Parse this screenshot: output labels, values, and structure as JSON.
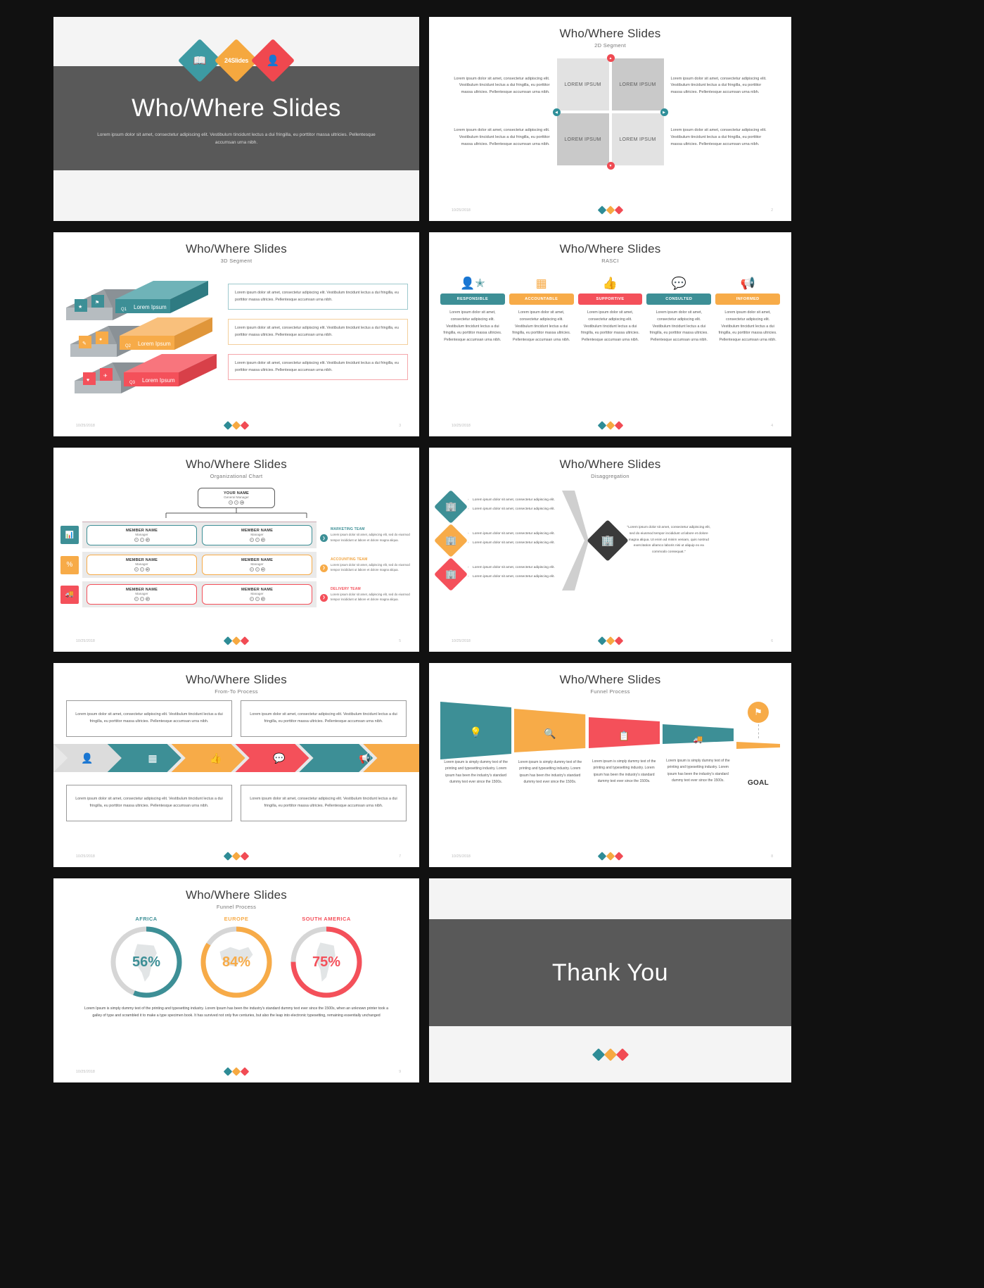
{
  "deck": {
    "title": "Who/Where Slides",
    "date": "10/25/2018",
    "brand_badge": "24Slides",
    "colors": {
      "teal": "#3d8f96",
      "orange": "#f7ab48",
      "red": "#f4505a",
      "dark": "#595959"
    }
  },
  "lorem": {
    "full": "Lorem ipsum dolor sit amet, consectetur adipiscing elit. Vestibulum tincidunt lectus a dui fringilla, eu porttitor massa ultricies. Pellentesque accumsan urna nibh.",
    "short": "Lorem ipsum dolor sit amet, consectetur adipiscing elit.",
    "med": "Lorem ipsum dolor sit amet, consectetur adipiscing elit. Vestibulum tincidunt lectus a dui fringilla, eu porttitor massa ultricies. Pellentesque accumsan urna nibh.",
    "note": "Lorem ipsum dolor sit amet, consectetur adipiscing elit. Vestibulum tincidunt lectus a dui fringilla, eu porttitor massa ultricies. Pellentesque accumsan urna nibh.",
    "team": "Lorem ipsum dolor sit amet, consectetur adipiscing elit, sed do eiusmod tempor incididunt ut labore et dolore magna aliqua.",
    "funnel": "Lorem ipsum is simply dummy text of the printing and typesetting industry. Lorem ipsum has been the industry's standard dummy text ever since the 1500s.",
    "quote": "\"Lorem ipsum dolor sit amet, consectetur adipiscing elit, sed do eiusmod tempor incididunt ut labore et dolore magna aliqua. Ut enim ad minim veniam, quis nostrud exercitation ullamco laboris nisi ut aliquip ex ea commodo consequat.\"",
    "donut_foot": "Lorem Ipsum is simply dummy text of the printing and typesetting industry. Lorem Ipsum has been the industry's standard dummy text ever since the 1500s, when an unknown printer took a galley of type and scrambled it to make a type specimen book. It has survived not only five centuries, but also the leap into electronic typesetting, remaining essentially unchanged"
  },
  "slides": [
    {
      "id": 1,
      "kind": "cover",
      "title": "Who/Where Slides",
      "subtitle": "",
      "body": "Lorem ipsum dolor sit amet, consectetur adipiscing elit. Vestibulum tincidunt lectus a dui fringilla, eu porttitor massa ultricies. Pellentesque accumsan urna nibh.",
      "icons": [
        "book-icon",
        "brand-24slides",
        "user-icon"
      ]
    },
    {
      "id": 2,
      "kind": "2d-segment",
      "subtitle": "2D Segment",
      "page": "2",
      "cells": [
        "LOREM IPSUM",
        "LOREM IPSUM",
        "LOREM IPSUM",
        "LOREM IPSUM"
      ],
      "texts": [
        "Lorem ipsum dolor sit amet, consectetur adipiscing elit. Vestibulum tincidunt lectus a dui fringilla, eu porttitor massa ultricies. Pellentesque accumsan urna nibh.",
        "Lorem ipsum dolor sit amet, consectetur adipiscing elit. Vestibulum tincidunt lectus a dui fringilla, eu porttitor massa ultricies. Pellentesque accumsan urna nibh.",
        "Lorem ipsum dolor sit amet, consectetur adipiscing elit. Vestibulum tincidunt lectus a dui fringilla, eu porttitor massa ultricies. Pellentesque accumsan urna nibh.",
        "Lorem ipsum dolor sit amet, consectetur adipiscing elit. Vestibulum tincidunt lectus a dui fringilla, eu porttitor massa ultricies. Pellentesque accumsan urna nibh."
      ]
    },
    {
      "id": 3,
      "kind": "3d-segment",
      "subtitle": "3D Segment",
      "page": "3",
      "slab_labels": [
        "Lorem Ipsum",
        "Lorem Ipsum",
        "Lorem Ipsum"
      ],
      "slab_tags": [
        "Q1",
        "Q2",
        "Q3"
      ],
      "notes": [
        "Lorem ipsum dolor sit amet, consectetur adipiscing elit. Vestibulum tincidunt lectus a dui fringilla, eu porttitor massa ultricies. Pellentesque accumsan urna nibh.",
        "Lorem ipsum dolor sit amet, consectetur adipiscing elit. Vestibulum tincidunt lectus a dui fringilla, eu porttitor massa ultricies. Pellentesque accumsan urna nibh.",
        "Lorem ipsum dolor sit amet, consectetur adipiscing elit. Vestibulum tincidunt lectus a dui fringilla, eu porttitor massa ultricies. Pellentesque accumsan urna nibh."
      ]
    },
    {
      "id": 4,
      "kind": "rasci",
      "subtitle": "RASCI",
      "page": "4",
      "columns": [
        {
          "tag": "RESPONSIBLE",
          "color": "teal",
          "icon": "user-star-icon",
          "body": "Lorem ipsum dolor sit amet, consectetur adipiscing elit. Vestibulum tincidunt lectus a dui fringilla, eu porttitor massa ultricies. Pellentesque accumsan urna nibh."
        },
        {
          "tag": "ACCOUNTABLE",
          "color": "orange",
          "icon": "abacus-icon",
          "body": "Lorem ipsum dolor sit amet, consectetur adipiscing elit. Vestibulum tincidunt lectus a dui fringilla, eu porttitor massa ultricies. Pellentesque accumsan urna nibh."
        },
        {
          "tag": "SUPPORTIVE",
          "color": "red",
          "icon": "thumbs-up-icon",
          "body": "Lorem ipsum dolor sit amet, consectetur adipiscing elit. Vestibulum tincidunt lectus a dui fringilla, eu porttitor massa ultricies. Pellentesque accumsan urna nibh."
        },
        {
          "tag": "CONSULTED",
          "color": "teal",
          "icon": "speech-bubbles-icon",
          "body": "Lorem ipsum dolor sit amet, consectetur adipiscing elit. Vestibulum tincidunt lectus a dui fringilla, eu porttitor massa ultricies. Pellentesque accumsan urna nibh."
        },
        {
          "tag": "INFORMED",
          "color": "orange",
          "icon": "megaphone-icon",
          "body": "Lorem ipsum dolor sit amet, consectetur adipiscing elit. Vestibulum tincidunt lectus a dui fringilla, eu porttitor massa ultricies. Pellentesque accumsan urna nibh."
        }
      ]
    },
    {
      "id": 5,
      "kind": "org-chart",
      "subtitle": "Organizational Chart",
      "page": "5",
      "root": {
        "name": "YOUR NAME",
        "role": "General Manager"
      },
      "members": [
        {
          "name": "MEMBER NAME",
          "role": "Manager"
        },
        {
          "name": "MEMBER NAME",
          "role": "Manager"
        },
        {
          "name": "MEMBER NAME",
          "role": "Manager"
        },
        {
          "name": "MEMBER NAME",
          "role": "Manager"
        },
        {
          "name": "MEMBER NAME",
          "role": "Manager"
        },
        {
          "name": "MEMBER NAME",
          "role": "Manager"
        }
      ],
      "teams": [
        {
          "label": "MARKETING TEAM",
          "color": "teal",
          "icon": "chart-icon",
          "body": "Lorem ipsum dolor sit amet, adipiscing elit, sed do eiusmod tempor incididunt ut labore et dolore magna aliqua."
        },
        {
          "label": "ACCOUNTING TEAM",
          "color": "orange",
          "icon": "percent-icon",
          "body": "Lorem ipsum dolor sit amet, adipiscing elit, sed do eiusmod tempor incididunt ut labore et dolore magna aliqua."
        },
        {
          "label": "DELIVERY TEAM",
          "color": "red",
          "icon": "truck-icon",
          "body": "Lorem ipsum dolor sit amet, adipiscing elit, sed do eiusmod tempor incididunt ut labore et dolore magna aliqua."
        }
      ]
    },
    {
      "id": 6,
      "kind": "disaggregation",
      "subtitle": "Disaggregation",
      "page": "6",
      "groups": [
        {
          "color": "teal",
          "icon": "building-icon",
          "bullets": [
            "Lorem ipsum dolor sit amet, consectetur adipiscing elit.",
            "Lorem ipsum dolor sit amet, consectetur adipiscing elit."
          ]
        },
        {
          "color": "orange",
          "icon": "building-icon",
          "bullets": [
            "Lorem ipsum dolor sit amet, consectetur adipiscing elit.",
            "Lorem ipsum dolor sit amet, consectetur adipiscing elit."
          ]
        },
        {
          "color": "red",
          "icon": "building-icon",
          "bullets": [
            "Lorem ipsum dolor sit amet, consectetur adipiscing elit.",
            "Lorem ipsum dolor sit amet, consectetur adipiscing elit."
          ]
        }
      ],
      "result_icon": "building-icon",
      "quote": "\"Lorem ipsum dolor sit amet, consectetur adipiscing elit, sed do eiusmod tempor incididunt ut labore et dolore magna aliqua. Ut enim ad minim veniam, quis nostrud exercitation ullamco laboris nisi ut aliquip ex ea commodo consequat.\""
    },
    {
      "id": 7,
      "kind": "from-to",
      "subtitle": "From-To Process",
      "page": "7",
      "top_boxes": [
        "Lorem ipsum dolor sit amet, consectetur adipiscing elit. Vestibulum tincidunt lectus a dui fringilla, eu porttitor massa ultricies. Pellentesque accumsan urna nibh.",
        "Lorem ipsum dolor sit amet, consectetur adipiscing elit. Vestibulum tincidunt lectus a dui fringilla, eu porttitor massa ultricies. Pellentesque accumsan urna nibh."
      ],
      "bottom_boxes": [
        "Lorem ipsum dolor sit amet, consectetur adipiscing elit. Vestibulum tincidunt lectus a dui fringilla, eu porttitor massa ultricies. Pellentesque accumsan urna nibh.",
        "Lorem ipsum dolor sit amet, consectetur adipiscing elit. Vestibulum tincidunt lectus a dui fringilla, eu porttitor massa ultricies. Pellentesque accumsan urna nibh."
      ],
      "arrows": [
        {
          "color": "teal",
          "icon": "user-star-icon"
        },
        {
          "color": "orange",
          "icon": "abacus-icon"
        },
        {
          "color": "red",
          "icon": "thumbs-up-icon"
        },
        {
          "color": "teal",
          "icon": "speech-bubbles-icon"
        },
        {
          "color": "orange",
          "icon": "megaphone-icon"
        }
      ]
    },
    {
      "id": 8,
      "kind": "funnel",
      "subtitle": "Funnel Process",
      "page": "8",
      "goal_label": "GOAL",
      "steps": [
        {
          "color": "teal",
          "icon": "lightbulb-icon",
          "text": "Lorem ipsum is simply dummy text of the printing and typesetting industry. Lorem ipsum has been the industry's standard dummy text ever since the 1500s."
        },
        {
          "color": "orange",
          "icon": "search-icon",
          "text": "Lorem ipsum is simply dummy text of the printing and typesetting industry. Lorem ipsum has been the industry's standard dummy text ever since the 1500s."
        },
        {
          "color": "red",
          "icon": "clipboard-icon",
          "text": "Lorem ipsum is simply dummy text of the printing and typesetting industry. Lorem ipsum has been the industry's standard dummy text ever since the 1500s."
        },
        {
          "color": "teal",
          "icon": "truck-icon",
          "text": "Lorem ipsum is simply dummy text of the printing and typesetting industry. Lorem ipsum has been the industry's standard dummy text ever since the 1500s."
        }
      ],
      "flag_icon": "flag-icon"
    },
    {
      "id": 9,
      "kind": "donuts",
      "subtitle": "Funnel Process",
      "page": "9",
      "footer_text": "Lorem Ipsum is simply dummy text of the printing and typesetting industry. Lorem Ipsum has been the industry's standard dummy text ever since the 1500s, when an unknown printer took a galley of type and scrambled it to make a type specimen book. It has survived not only five centuries, but also the leap into electronic typesetting, remaining essentially unchanged"
    },
    {
      "id": 10,
      "kind": "thank-you",
      "title": "Thank You"
    }
  ],
  "chart_data": {
    "type": "pie",
    "title": "Who/Where Slides — Funnel Process",
    "charts": [
      {
        "label": "AFRICA",
        "value": 56,
        "display": "56%",
        "color": "#3d8f96",
        "track": "#d6d6d6",
        "max": 100
      },
      {
        "label": "EUROPE",
        "value": 84,
        "display": "84%",
        "color": "#f7ab48",
        "track": "#d6d6d6",
        "max": 100
      },
      {
        "label": "SOUTH AMERICA",
        "value": 75,
        "display": "75%",
        "color": "#f4505a",
        "track": "#d6d6d6",
        "max": 100
      }
    ],
    "legend": [
      "AFRICA",
      "EUROPE",
      "SOUTH AMERICA"
    ],
    "ylabel": "",
    "xlabel": ""
  }
}
